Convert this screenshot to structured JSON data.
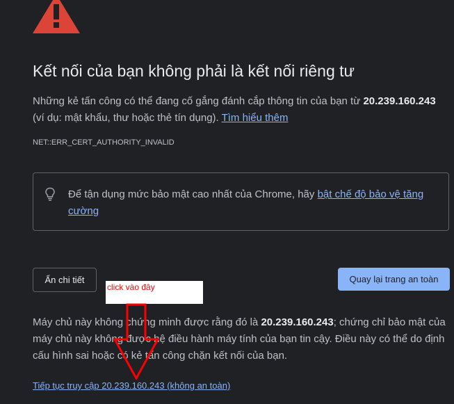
{
  "icons": {
    "warning": "warning-triangle-icon",
    "tip": "lightbulb-icon",
    "annotation_arrow": "arrow-down-icon"
  },
  "colors": {
    "background": "#202124",
    "warning": "#db4437",
    "link": "#8ab4f8",
    "primary_button": "#8ab4f8",
    "annotation": "#ff0000"
  },
  "heading": {
    "title": "Kết nối của bạn không phải là kết nối riêng tư"
  },
  "description": {
    "prefix": "Những kẻ tấn công có thể đang cố gắng đánh cắp thông tin của bạn từ ",
    "host": "20.239.160.243",
    "suffix": " (ví dụ: mật khẩu, thư hoặc thẻ tín dụng). ",
    "learn_more": "Tìm hiểu thêm"
  },
  "error_code": "NET::ERR_CERT_AUTHORITY_INVALID",
  "tip": {
    "prefix": "Để tận dụng mức bảo mật cao nhất của Chrome, hãy ",
    "link": "bật chế độ bảo vệ tăng cường"
  },
  "buttons": {
    "details": "Ẩn chi tiết",
    "back_to_safety": "Quay lại trang an toàn"
  },
  "annotation": {
    "label": "click vào đây"
  },
  "details": {
    "prefix": "Máy chủ này không chứng minh được rằng đó là ",
    "host": "20.239.160.243",
    "suffix": "; chứng chỉ bảo mật của máy chủ này không được hệ điều hành máy tính của bạn tin cậy. Điều này có thể do định cấu hình sai hoặc có kẻ tấn công chặn kết nối của bạn."
  },
  "proceed_link": "Tiếp tục truy cập 20.239.160.243 (không an toàn)"
}
